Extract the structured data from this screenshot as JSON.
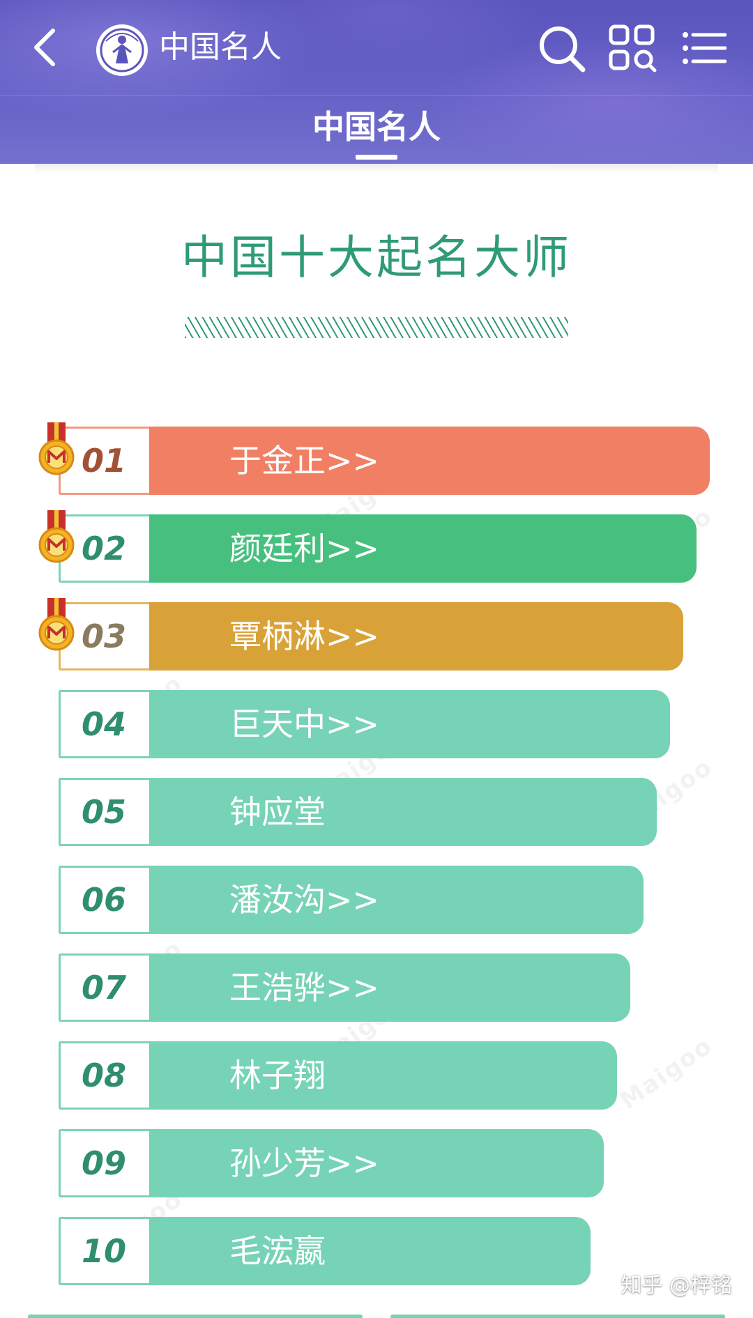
{
  "header": {
    "app_title": "中国名人",
    "tab_label": "中国名人"
  },
  "main": {
    "title": "中国十大起名大师"
  },
  "ranking": [
    {
      "rank": "01",
      "name": "于金正>>"
    },
    {
      "rank": "02",
      "name": "颜廷利>>"
    },
    {
      "rank": "03",
      "name": "覃柄淋>>"
    },
    {
      "rank": "04",
      "name": "巨天中>>"
    },
    {
      "rank": "05",
      "name": "钟应堂"
    },
    {
      "rank": "06",
      "name": "潘汝沟>>"
    },
    {
      "rank": "07",
      "name": "王浩骅>>"
    },
    {
      "rank": "08",
      "name": "林子翔"
    },
    {
      "rank": "09",
      "name": "孙少芳>>"
    },
    {
      "rank": "10",
      "name": "毛浤嬴"
    }
  ],
  "footer": {
    "credit": "知乎 @梓铭"
  },
  "colors": {
    "header_bg": "#5a55bd",
    "title_green": "#2f9b76",
    "rank1": "#f07f64",
    "rank2": "#47c07f",
    "rank3": "#d9a239",
    "rank_default": "#77d3b6"
  },
  "icons": [
    "back-icon",
    "logo-icon",
    "search-icon",
    "grid-icon",
    "menu-icon",
    "medal-icon"
  ]
}
